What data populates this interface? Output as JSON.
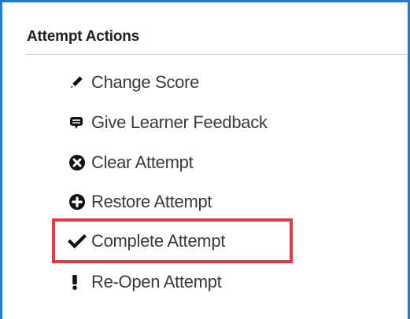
{
  "panel": {
    "title": "Attempt Actions"
  },
  "actions": [
    {
      "label": "Change Score",
      "icon": "pencil-icon"
    },
    {
      "label": "Give Learner Feedback",
      "icon": "comment-icon"
    },
    {
      "label": "Clear Attempt",
      "icon": "times-circle-icon"
    },
    {
      "label": "Restore Attempt",
      "icon": "plus-circle-icon"
    },
    {
      "label": "Complete Attempt",
      "icon": "checkmark-icon"
    },
    {
      "label": "Re-Open Attempt",
      "icon": "exclamation-icon"
    }
  ],
  "highlight": {
    "target": "Complete Attempt",
    "color": "#e03a44"
  },
  "colors": {
    "frame_border": "#2a78c8",
    "text": "#3a3a3a",
    "title": "#222222",
    "icon": "#111111"
  }
}
